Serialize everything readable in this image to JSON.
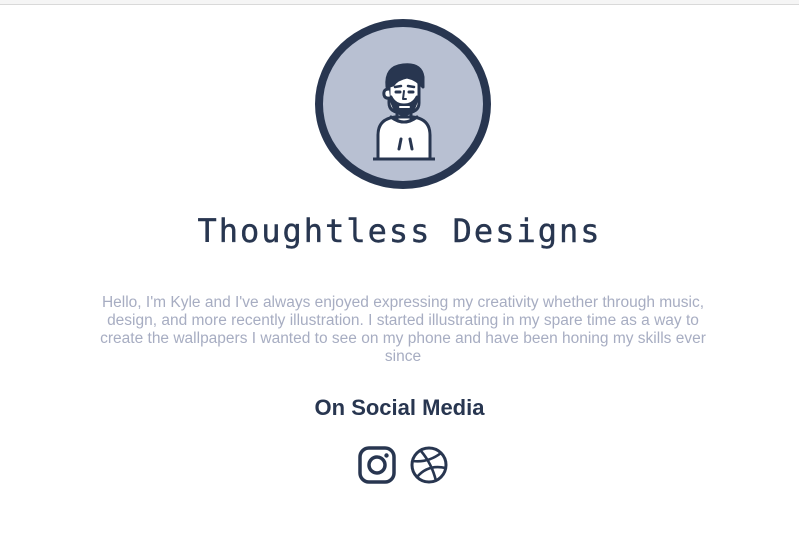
{
  "profile": {
    "name": "Thoughtless Designs",
    "bio": "Hello, I'm Kyle and I've always enjoyed expressing my creativity whether through music, design, and more recently illustration. I started illustrating in my spare time as a way to create the wallpapers I wanted to see on my phone and have been honing my skills ever since"
  },
  "social": {
    "heading": "On Social Media",
    "links": [
      {
        "name": "instagram",
        "icon": "instagram-icon"
      },
      {
        "name": "dribbble",
        "icon": "dribbble-icon"
      }
    ]
  },
  "colors": {
    "primary": "#283650",
    "avatar_bg": "#b8c0d2",
    "bio_text": "#a7adc2",
    "background": "#ffffff"
  }
}
